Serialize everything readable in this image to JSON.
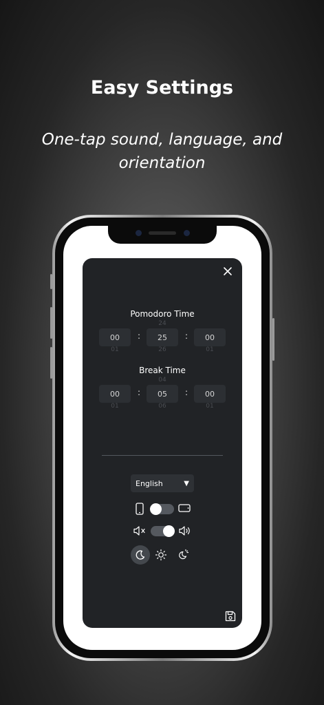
{
  "headline": "Easy Settings",
  "subheadline": "One-tap sound, language, and orientation",
  "settings_panel": {
    "pomodoro": {
      "title": "Pomodoro Time",
      "hours": {
        "prev": "",
        "value": "00",
        "next": "01"
      },
      "minutes": {
        "prev": "24",
        "value": "25",
        "next": "26"
      },
      "seconds": {
        "prev": "",
        "value": "00",
        "next": "01"
      },
      "separator": ":"
    },
    "break": {
      "title": "Break Time",
      "hours": {
        "prev": "",
        "value": "00",
        "next": "01"
      },
      "minutes": {
        "prev": "04",
        "value": "05",
        "next": "06"
      },
      "seconds": {
        "prev": "",
        "value": "00",
        "next": "01"
      },
      "separator": ":"
    },
    "language": {
      "selected": "English",
      "caret": "▼"
    },
    "orientation_toggle": {
      "left_icon": "portrait-icon",
      "right_icon": "landscape-icon",
      "state": "portrait"
    },
    "sound_toggle": {
      "left_icon": "mute-icon",
      "right_icon": "volume-icon",
      "state": "on"
    },
    "theme_options": [
      "moon-icon",
      "sun-icon",
      "auto-theme-icon"
    ],
    "theme_selected": "moon-icon",
    "close_icon": "close-icon",
    "save_icon": "save-icon"
  },
  "colors": {
    "panel_bg": "#212326",
    "picker_bg": "#2c2f33",
    "text": "#ffffff"
  }
}
